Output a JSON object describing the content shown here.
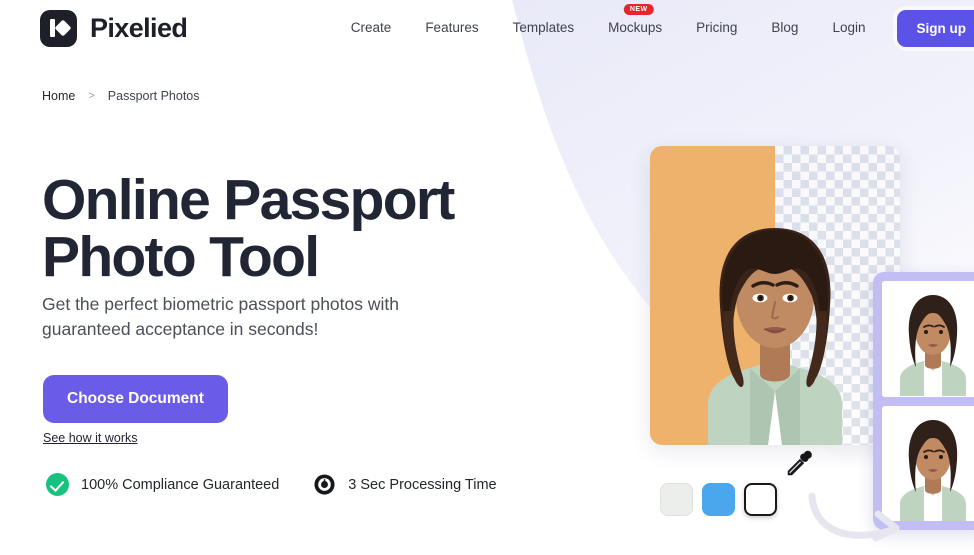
{
  "brand": {
    "name": "Pixelied",
    "logo_icon": "pixelied-logo-icon"
  },
  "nav": {
    "items": [
      {
        "label": "Create",
        "badge": null
      },
      {
        "label": "Features",
        "badge": null
      },
      {
        "label": "Templates",
        "badge": null
      },
      {
        "label": "Mockups",
        "badge": "NEW"
      },
      {
        "label": "Pricing",
        "badge": null
      },
      {
        "label": "Blog",
        "badge": null
      },
      {
        "label": "Login",
        "badge": null
      }
    ],
    "cta_label": "Sign up"
  },
  "breadcrumb": {
    "home": "Home",
    "separator": ">",
    "current": "Passport Photos"
  },
  "hero": {
    "title": "Online Passport Photo Tool",
    "subtitle": "Get the perfect biometric passport photos with guaranteed acceptance in seconds!",
    "cta_label": "Choose Document",
    "secondary_link": "See how it works",
    "features": [
      {
        "icon": "check-circle-icon",
        "label": "100% Compliance Guaranteed"
      },
      {
        "icon": "stopwatch-icon",
        "label": "3 Sec Processing Time"
      }
    ]
  },
  "editor": {
    "swatches": [
      {
        "name": "swatch-light-gray",
        "color": "#eceeeb",
        "selected": false
      },
      {
        "name": "swatch-blue",
        "color": "#4aa7ee",
        "selected": false
      },
      {
        "name": "swatch-white",
        "color": "#ffffff",
        "selected": true
      }
    ],
    "eyedropper_icon": "eyedropper-icon",
    "arrow_icon": "curved-arrow-icon"
  },
  "colors": {
    "accent_purple": "#6b5ce7",
    "nav_cta_purple": "#5b52e8",
    "badge_red": "#e8252a",
    "success_green": "#17c27e",
    "heading_navy": "#222634",
    "bg_lavender": "#edeefa",
    "photo_backdrop_orange": "#eeb26c",
    "thumb_card_lavender": "#c2bdf2"
  }
}
